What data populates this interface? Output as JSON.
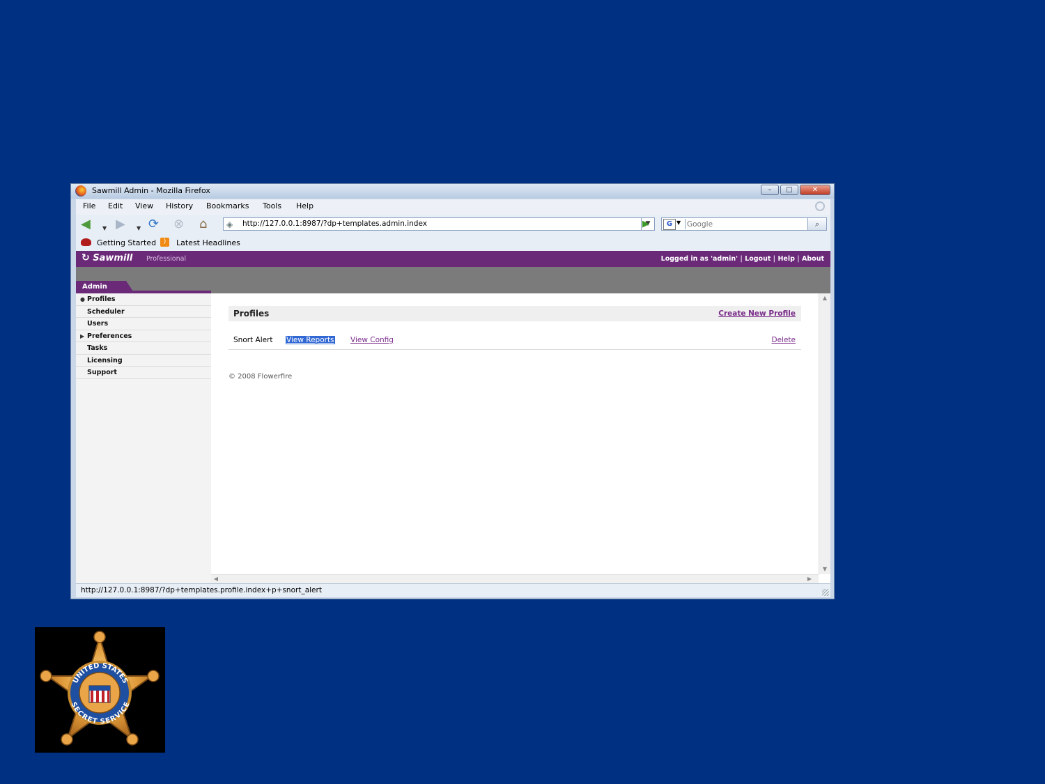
{
  "window": {
    "title": "Sawmill Admin - Mozilla Firefox",
    "controls": {
      "minimize": "–",
      "maximize": "□",
      "close": "✕"
    }
  },
  "menu": {
    "items": [
      "File",
      "Edit",
      "View",
      "History",
      "Bookmarks",
      "Tools",
      "Help"
    ]
  },
  "nav": {
    "url": "http://127.0.0.1:8987/?dp+templates.admin.index",
    "search_placeholder": "Google",
    "search_engine": "G"
  },
  "bookmarks": {
    "items": [
      "Getting Started",
      "Latest Headlines"
    ]
  },
  "app": {
    "logo": "Sawmill",
    "edition": "Professional",
    "logged_in": "Logged in as 'admin'",
    "links": [
      "Logout",
      "Help",
      "About"
    ],
    "section_tab": "Admin",
    "accent_color": "#6a2a78"
  },
  "sidebar": {
    "items": [
      "Profiles",
      "Scheduler",
      "Users",
      "Preferences",
      "Tasks",
      "Licensing",
      "Support"
    ],
    "active": "Profiles"
  },
  "profiles": {
    "title": "Profiles",
    "create_label": "Create New Profile",
    "rows": [
      {
        "name": "Snort Alert",
        "view_reports": "View Reports",
        "view_config": "View Config",
        "delete": "Delete"
      }
    ],
    "footer": "© 2008 Flowerfire"
  },
  "status": {
    "text": "http://127.0.0.1:8987/?dp+templates.profile.index+p+snort_alert"
  },
  "badge": {
    "text_top": "UNITED STATES",
    "text_bottom": "SECRET SERVICE"
  }
}
